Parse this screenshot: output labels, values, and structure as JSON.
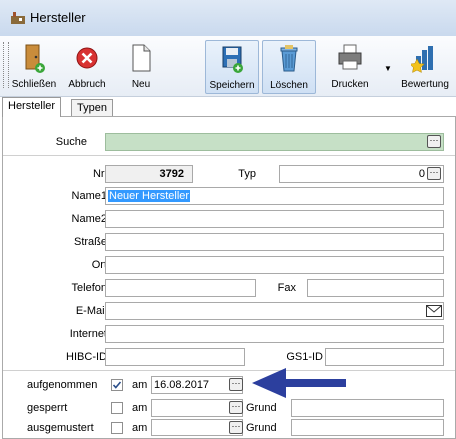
{
  "window": {
    "title": "Hersteller"
  },
  "toolbar": {
    "buttons": [
      {
        "label": "Schließen",
        "icon": "door-exit-icon"
      },
      {
        "label": "Abbruch",
        "icon": "cancel-icon"
      },
      {
        "label": "Neu",
        "icon": "new-document-icon"
      },
      {
        "label": "Speichern",
        "icon": "save-icon"
      },
      {
        "label": "Löschen",
        "icon": "trash-icon"
      },
      {
        "label": "Drucken",
        "icon": "printer-icon"
      },
      {
        "label": "Bewertung",
        "icon": "rating-chart-icon"
      }
    ],
    "dropdown_glyph": "▼"
  },
  "tabs": [
    "Hersteller",
    "Typen"
  ],
  "form": {
    "search_label": "Suche",
    "search_value": "",
    "search_color": "#c6e0c6",
    "nr_label": "Nr.",
    "nr_value": "3792",
    "typ_label": "Typ",
    "typ_value": "0",
    "name1_label": "Name1",
    "name1_value": "Neuer Hersteller",
    "name2_label": "Name2",
    "strasse_label": "Straße",
    "ort_label": "Ort",
    "telefon_label": "Telefon",
    "fax_label": "Fax",
    "email_label": "E-Mail",
    "internet_label": "Internet",
    "hibc_label": "HIBC-ID",
    "gs1_label": "GS1-ID",
    "aufgenommen_label": "aufgenommen",
    "aufgenommen_checked": true,
    "am_label": "am",
    "aufgenommen_date": "16.08.2017",
    "gesperrt_label": "gesperrt",
    "ausgemustert_label": "ausgemustert",
    "grund_label": "Grund",
    "dots_glyph": "···",
    "arrow_color": "#2c3f9e",
    "selection_color": "#3399ff"
  }
}
